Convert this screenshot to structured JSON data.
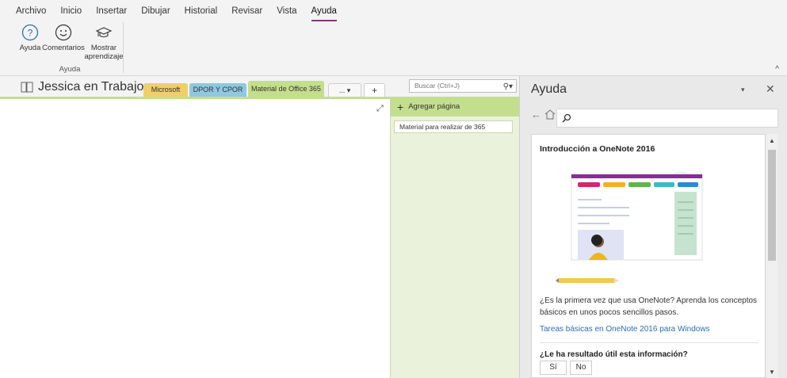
{
  "menu": {
    "items": [
      "Archivo",
      "Inicio",
      "Insertar",
      "Dibujar",
      "Historial",
      "Revisar",
      "Vista",
      "Ayuda"
    ],
    "active_index": 7
  },
  "ribbon": {
    "buttons": [
      {
        "label": "Ayuda",
        "icon": "help-icon"
      },
      {
        "label": "Comentarios",
        "icon": "smiley-icon"
      },
      {
        "label": "Mostrar aprendizaje",
        "icon": "graduation-cap-icon"
      }
    ],
    "group_label": "Ayuda",
    "collapse_glyph": "^"
  },
  "notebook": {
    "title": "Jessica en Trabajo",
    "caret": "▾",
    "tabs": [
      "Microsoft",
      "DPOR Y CPOR",
      "Material de Office 365"
    ],
    "more_tab": "... ▾",
    "add_tab": "+"
  },
  "search": {
    "placeholder": "Buscar (Ctrl+J)",
    "icon": "search-icon"
  },
  "pages": {
    "add_label": "Agregar página",
    "items": [
      "Material para realizar de 365"
    ]
  },
  "help": {
    "title": "Ayuda",
    "dropdown_glyph": "▾",
    "close_glyph": "✕",
    "card": {
      "title": "Introducción a OneNote 2016",
      "description": "¿Es la primera vez que usa OneNote? Aprenda los conceptos básicos en unos pocos sencillos pasos.",
      "link": "Tareas básicas en OneNote 2016 para Windows",
      "question": "¿Le ha resultado útil esta información?",
      "yes": "Sí",
      "no": "No"
    }
  },
  "colors": {
    "accent": "#80397b",
    "tab_microsoft": "#f0cf6b",
    "tab_dpor": "#8fc8e0",
    "tab_office": "#c3df8e",
    "link": "#2a6ebb"
  }
}
